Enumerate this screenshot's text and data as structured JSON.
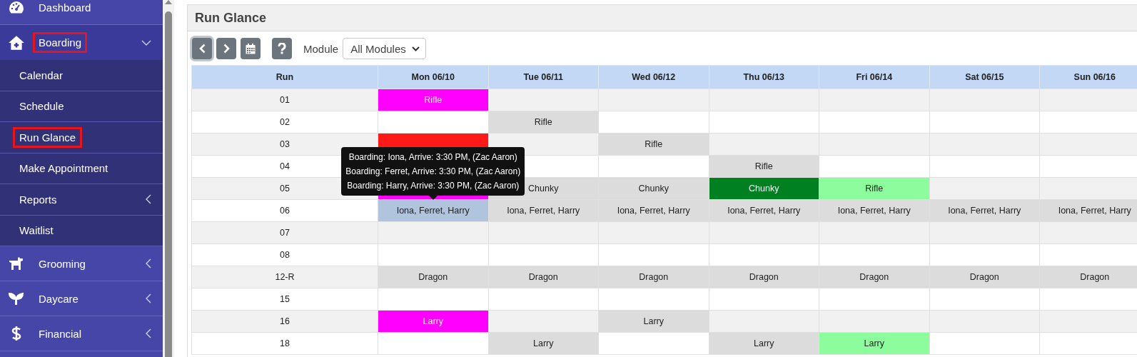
{
  "sidebar": {
    "items": [
      {
        "label": "Dashboard",
        "has_submenu": false,
        "expanded": false,
        "highlighted": false
      },
      {
        "label": "Boarding",
        "has_submenu": true,
        "expanded": true,
        "highlighted": true,
        "children": [
          {
            "label": "Calendar",
            "has_submenu": false,
            "highlighted": false
          },
          {
            "label": "Schedule",
            "has_submenu": false,
            "highlighted": false
          },
          {
            "label": "Run Glance",
            "has_submenu": false,
            "highlighted": true
          },
          {
            "label": "Make Appointment",
            "has_submenu": false,
            "highlighted": false
          },
          {
            "label": "Reports",
            "has_submenu": true,
            "highlighted": false
          },
          {
            "label": "Waitlist",
            "has_submenu": false,
            "highlighted": false
          }
        ]
      },
      {
        "label": "Grooming",
        "has_submenu": true,
        "expanded": false,
        "highlighted": false
      },
      {
        "label": "Daycare",
        "has_submenu": true,
        "expanded": false,
        "highlighted": false
      },
      {
        "label": "Financial",
        "has_submenu": true,
        "expanded": false,
        "highlighted": false
      }
    ]
  },
  "page": {
    "title": "Run Glance"
  },
  "toolbar": {
    "buttons": [
      {
        "kind": "prev",
        "focused": true
      },
      {
        "kind": "next",
        "focused": false
      },
      {
        "kind": "calendar",
        "focused": false
      },
      {
        "kind": "help",
        "focused": false
      }
    ],
    "module_label": "Module",
    "module_value": "All Modules"
  },
  "table": {
    "columns": [
      "Run",
      "Mon 06/10",
      "Tue 06/11",
      "Wed 06/12",
      "Thu 06/13",
      "Fri 06/14",
      "Sat 06/15",
      "Sun 06/16"
    ],
    "rows": [
      {
        "cells": [
          {
            "kind": "run",
            "text": "01"
          },
          {
            "kind": "booked",
            "text": "Rifle",
            "color": "#ff00ff"
          },
          {
            "kind": "empty"
          },
          {
            "kind": "empty"
          },
          {
            "kind": "empty"
          },
          {
            "kind": "empty"
          },
          {
            "kind": "empty"
          },
          {
            "kind": "empty"
          }
        ]
      },
      {
        "cells": [
          {
            "kind": "run",
            "text": "02"
          },
          {
            "kind": "empty"
          },
          {
            "kind": "booked",
            "text": "Rifle",
            "color": "#dcdcdc"
          },
          {
            "kind": "empty"
          },
          {
            "kind": "empty"
          },
          {
            "kind": "empty"
          },
          {
            "kind": "empty"
          },
          {
            "kind": "empty"
          }
        ]
      },
      {
        "cells": [
          {
            "kind": "run",
            "text": "03"
          },
          {
            "kind": "booked",
            "color": "#ff1a1a"
          },
          {
            "kind": "empty"
          },
          {
            "kind": "booked",
            "text": "Rifle",
            "color": "#dcdcdc"
          },
          {
            "kind": "empty"
          },
          {
            "kind": "empty"
          },
          {
            "kind": "empty"
          },
          {
            "kind": "empty"
          }
        ]
      },
      {
        "cells": [
          {
            "kind": "run",
            "text": "04"
          },
          {
            "kind": "empty"
          },
          {
            "kind": "empty"
          },
          {
            "kind": "empty"
          },
          {
            "kind": "booked",
            "text": "Rifle",
            "color": "#dcdcdc"
          },
          {
            "kind": "empty"
          },
          {
            "kind": "empty"
          },
          {
            "kind": "empty"
          }
        ]
      },
      {
        "cells": [
          {
            "kind": "run",
            "text": "05"
          },
          {
            "kind": "booked",
            "color": "#ff00ff"
          },
          {
            "kind": "booked",
            "text": "Chunky",
            "color": "#dcdcdc"
          },
          {
            "kind": "booked",
            "text": "Chunky",
            "color": "#dcdcdc"
          },
          {
            "kind": "booked",
            "text": "Chunky",
            "color": "#008020"
          },
          {
            "kind": "booked",
            "text": "Rifle",
            "color": "#8cfc9c"
          },
          {
            "kind": "empty"
          },
          {
            "kind": "empty"
          }
        ]
      },
      {
        "cells": [
          {
            "kind": "run",
            "text": "06"
          },
          {
            "kind": "booked",
            "text": "Iona, Ferret, Harry",
            "color": "#b0c4de",
            "tooltip": [
              "Boarding: Iona, Arrive: 3:30 PM, (Zac Aaron)",
              "Boarding: Ferret, Arrive: 3:30 PM, (Zac Aaron)",
              "Boarding: Harry, Arrive: 3:30 PM, (Zac Aaron)"
            ]
          },
          {
            "kind": "booked",
            "text": "Iona, Ferret, Harry",
            "color": "#dcdcdc"
          },
          {
            "kind": "booked",
            "text": "Iona, Ferret, Harry",
            "color": "#dcdcdc"
          },
          {
            "kind": "booked",
            "text": "Iona, Ferret, Harry",
            "color": "#dcdcdc"
          },
          {
            "kind": "booked",
            "text": "Iona, Ferret, Harry",
            "color": "#dcdcdc"
          },
          {
            "kind": "booked",
            "text": "Iona, Ferret, Harry",
            "color": "#dcdcdc"
          },
          {
            "kind": "booked",
            "text": "Iona, Ferret, Harry",
            "color": "#dcdcdc"
          }
        ]
      },
      {
        "cells": [
          {
            "kind": "run",
            "text": "07"
          },
          {
            "kind": "empty"
          },
          {
            "kind": "empty"
          },
          {
            "kind": "empty"
          },
          {
            "kind": "empty"
          },
          {
            "kind": "empty"
          },
          {
            "kind": "empty"
          },
          {
            "kind": "empty"
          }
        ]
      },
      {
        "cells": [
          {
            "kind": "run",
            "text": "08"
          },
          {
            "kind": "empty"
          },
          {
            "kind": "empty"
          },
          {
            "kind": "empty"
          },
          {
            "kind": "empty"
          },
          {
            "kind": "empty"
          },
          {
            "kind": "empty"
          },
          {
            "kind": "empty"
          }
        ]
      },
      {
        "cells": [
          {
            "kind": "run",
            "text": "12-R"
          },
          {
            "kind": "booked",
            "text": "Dragon",
            "color": "#dcdcdc"
          },
          {
            "kind": "booked",
            "text": "Dragon",
            "color": "#dcdcdc"
          },
          {
            "kind": "booked",
            "text": "Dragon",
            "color": "#dcdcdc"
          },
          {
            "kind": "booked",
            "text": "Dragon",
            "color": "#dcdcdc"
          },
          {
            "kind": "booked",
            "text": "Dragon",
            "color": "#dcdcdc"
          },
          {
            "kind": "booked",
            "text": "Dragon",
            "color": "#dcdcdc"
          },
          {
            "kind": "booked",
            "text": "Dragon",
            "color": "#dcdcdc"
          }
        ]
      },
      {
        "cells": [
          {
            "kind": "run",
            "text": "15"
          },
          {
            "kind": "empty"
          },
          {
            "kind": "empty"
          },
          {
            "kind": "empty"
          },
          {
            "kind": "empty"
          },
          {
            "kind": "empty"
          },
          {
            "kind": "empty"
          },
          {
            "kind": "empty"
          }
        ]
      },
      {
        "cells": [
          {
            "kind": "run",
            "text": "16"
          },
          {
            "kind": "booked",
            "text": "Larry",
            "color": "#ff00ff"
          },
          {
            "kind": "empty"
          },
          {
            "kind": "booked",
            "text": "Larry",
            "color": "#dcdcdc"
          },
          {
            "kind": "empty"
          },
          {
            "kind": "empty"
          },
          {
            "kind": "empty"
          },
          {
            "kind": "empty"
          }
        ]
      },
      {
        "cells": [
          {
            "kind": "run",
            "text": "18"
          },
          {
            "kind": "empty"
          },
          {
            "kind": "booked",
            "text": "Larry",
            "color": "#dcdcdc"
          },
          {
            "kind": "empty"
          },
          {
            "kind": "booked",
            "text": "Larry",
            "color": "#dcdcdc"
          },
          {
            "kind": "booked",
            "text": "Larry",
            "color": "#8cfc9c"
          },
          {
            "kind": "empty"
          },
          {
            "kind": "empty"
          }
        ]
      }
    ]
  }
}
